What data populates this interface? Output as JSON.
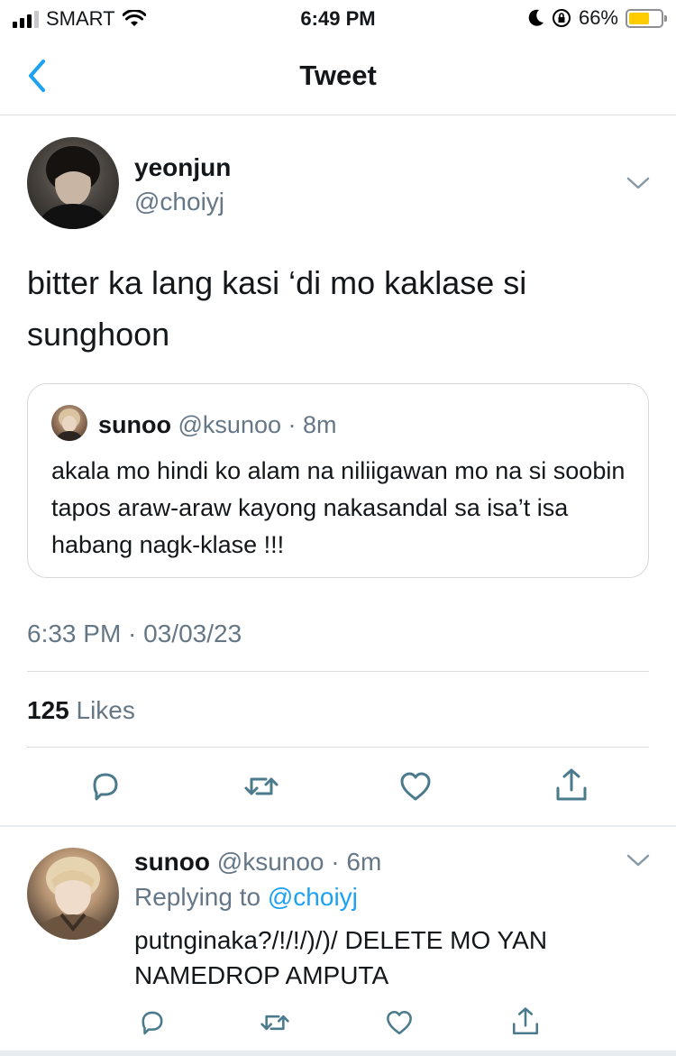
{
  "status_bar": {
    "carrier": "SMART",
    "time": "6:49 PM",
    "battery": "66%",
    "battery_level": 0.66
  },
  "nav": {
    "title": "Tweet",
    "back_icon": "chevron-left-icon"
  },
  "tweet": {
    "author_name": "yeonjun",
    "author_handle": "@choiyj",
    "text": "bitter ka lang kasi ‘di mo kaklase si sunghoon",
    "quoted": {
      "name": "sunoo",
      "handle": "@ksunoo",
      "time": "· 8m",
      "text": "akala mo hindi ko alam na niliigawan mo na si soobin tapos araw-araw kayong nakasandal sa isa’t isa habang nagk-klase !!!"
    },
    "timestamp": "6:33 PM · 03/03/23",
    "likes_count": "125",
    "likes_label": "Likes"
  },
  "reply": {
    "name": "sunoo",
    "handle": "@ksunoo",
    "time": "· 6m",
    "replying_to_label": "Replying to",
    "replying_to_handle": "@choiyj",
    "text": "putnginaka?/!/!/)/)/ DELETE MO YAN NAMEDROP AMPUTA"
  },
  "colors": {
    "accent": "#1da1f2",
    "secondary_text": "#657786",
    "action_icon": "#4a7a8c",
    "battery_fill": "#ffcc00"
  }
}
